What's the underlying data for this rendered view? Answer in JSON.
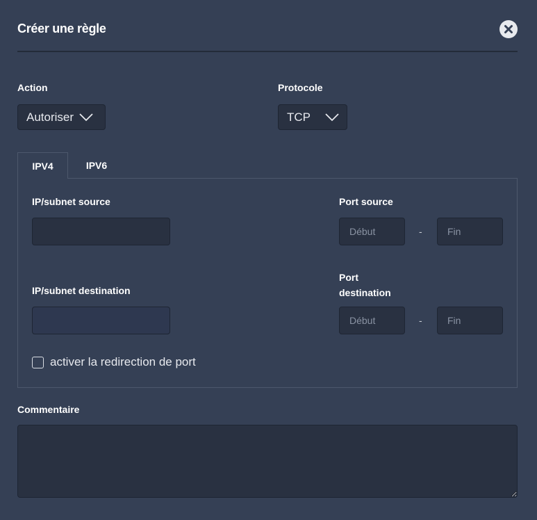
{
  "dialog": {
    "title": "Créer une règle",
    "close_icon": "close-icon"
  },
  "action": {
    "label": "Action",
    "value": "Autoriser"
  },
  "protocol": {
    "label": "Protocole",
    "value": "TCP"
  },
  "tabs": [
    {
      "label": "IPV4",
      "active": true
    },
    {
      "label": "IPV6",
      "active": false
    }
  ],
  "ipv4": {
    "source_label": "IP/subnet source",
    "source_value": "",
    "port_source_label": "Port source",
    "port_source_start_placeholder": "Début",
    "port_source_end_placeholder": "Fin",
    "dash": "-",
    "destination_label": "IP/subnet destination",
    "destination_value": "",
    "port_destination_label_line1": "Port",
    "port_destination_label_line2": "destination",
    "port_destination_start_placeholder": "Début",
    "port_destination_end_placeholder": "Fin",
    "port_forward_label": "activer la redirection de port",
    "port_forward_checked": false
  },
  "comment": {
    "label": "Commentaire",
    "value": ""
  },
  "colors": {
    "background": "#354055",
    "input_background": "#293141",
    "border": "#4d586c",
    "text": "#ffffff"
  }
}
